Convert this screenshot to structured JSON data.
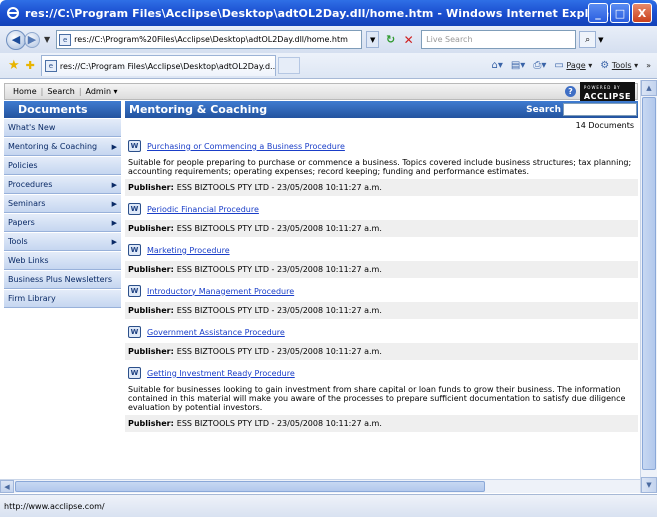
{
  "window": {
    "title": "res://C:\\Program Files\\Acclipse\\Desktop\\adtOL2Day.dll/home.htm - Windows Internet Explorer",
    "minimize": "_",
    "maximize": "□",
    "close": "X"
  },
  "address_bar": {
    "url": "res://C:\\Program%20Files\\Acclipse\\Desktop\\adtOL2Day.dll/home.htm",
    "search_placeholder": "Live Search"
  },
  "tab": {
    "title": "res://C:\\Program Files\\Acclipse\\Desktop\\adtOL2Day.d..."
  },
  "commands": {
    "page": "Page",
    "tools": "Tools"
  },
  "site_nav": {
    "home": "Home",
    "search": "Search",
    "admin": "Admin",
    "logo_top": "POWERED BY",
    "logo": "ACCLIPSE"
  },
  "sidebar": {
    "heading": "Documents",
    "items": [
      {
        "label": "What's New",
        "arrow": ""
      },
      {
        "label": "Mentoring & Coaching",
        "arrow": "▶"
      },
      {
        "label": "Policies",
        "arrow": ""
      },
      {
        "label": "Procedures",
        "arrow": "▶"
      },
      {
        "label": "Seminars",
        "arrow": "▶"
      },
      {
        "label": "Papers",
        "arrow": "▶"
      },
      {
        "label": "Tools",
        "arrow": "▶"
      },
      {
        "label": "Web Links",
        "arrow": ""
      },
      {
        "label": "Business Plus Newsletters",
        "arrow": ""
      },
      {
        "label": "Firm Library",
        "arrow": ""
      }
    ]
  },
  "main": {
    "heading": "Mentoring & Coaching",
    "search_label": "Search",
    "count": "14 Documents",
    "publisher_label": "Publisher:",
    "documents": [
      {
        "title": "Purchasing or Commencing a Business Procedure",
        "description": "Suitable for people preparing to purchase or commence a business. Topics covered include business structures; tax planning; accounting requirements; operating expenses; record keeping; funding and performance estimates.",
        "publisher": "ESS BIZTOOLS PTY LTD - 23/05/2008 10:11:27 a.m."
      },
      {
        "title": "Periodic Financial Procedure",
        "description": "",
        "publisher": "ESS BIZTOOLS PTY LTD - 23/05/2008 10:11:27 a.m."
      },
      {
        "title": "Marketing Procedure",
        "description": "",
        "publisher": "ESS BIZTOOLS PTY LTD - 23/05/2008 10:11:27 a.m."
      },
      {
        "title": "Introductory Management Procedure",
        "description": "",
        "publisher": "ESS BIZTOOLS PTY LTD - 23/05/2008 10:11:27 a.m."
      },
      {
        "title": "Government Assistance Procedure",
        "description": "",
        "publisher": "ESS BIZTOOLS PTY LTD - 23/05/2008 10:11:27 a.m."
      },
      {
        "title": "Getting Investment Ready Procedure",
        "description": "Suitable for businesses looking to gain investment from share capital or loan funds to grow their business. The information contained in this material will make you aware of the processes to prepare sufficient documentation to satisfy due diligence evaluation by potential investors.",
        "publisher": "ESS BIZTOOLS PTY LTD - 23/05/2008 10:11:27 a.m."
      }
    ]
  },
  "status": {
    "text": "http://www.acclipse.com/"
  }
}
